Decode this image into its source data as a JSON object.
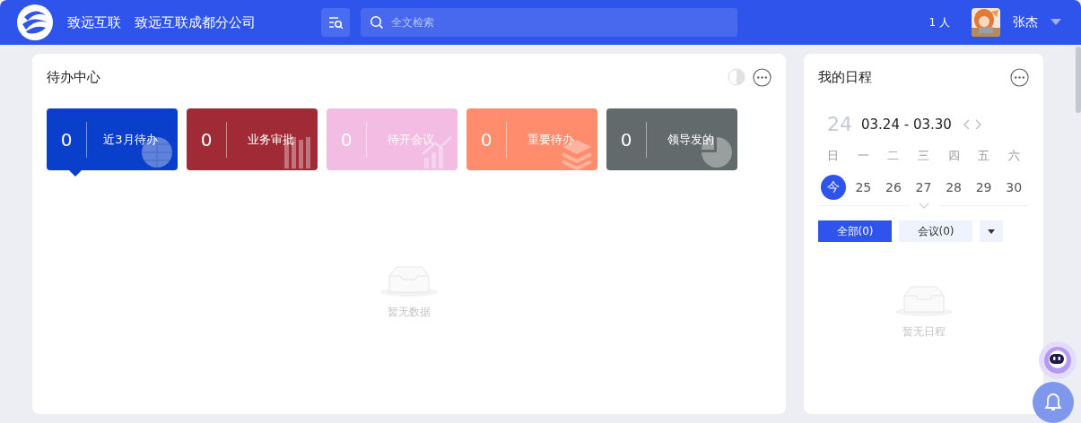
{
  "header": {
    "org": "致远互联",
    "company": "致远互联成都分公司",
    "search": {
      "placeholder": "全文检索"
    },
    "online_count": "1 人",
    "user": {
      "name": "张杰"
    }
  },
  "todo": {
    "title": "待办中心",
    "tiles": [
      {
        "count": "0",
        "label": "近3月待办",
        "color": "#0a3fcc",
        "kind": "globe",
        "selected": true
      },
      {
        "count": "0",
        "label": "业务审批",
        "color": "#a02a36",
        "kind": "books",
        "selected": false
      },
      {
        "count": "0",
        "label": "待开会议",
        "color": "#f2bce3",
        "kind": "chart",
        "selected": false
      },
      {
        "count": "0",
        "label": "重要待办",
        "color": "#ff8c6c",
        "kind": "layers",
        "selected": false
      },
      {
        "count": "0",
        "label": "领导发的",
        "color": "#636a6b",
        "kind": "pie",
        "selected": false
      }
    ],
    "empty_text": "暂无数据"
  },
  "schedule": {
    "title": "我的日程",
    "day": "24",
    "range": "03.24 - 03.30",
    "weekdays": [
      "日",
      "一",
      "二",
      "三",
      "四",
      "五",
      "六"
    ],
    "dates": [
      {
        "label": "今",
        "selected": true
      },
      {
        "label": "25",
        "selected": false
      },
      {
        "label": "26",
        "selected": false
      },
      {
        "label": "27",
        "selected": false
      },
      {
        "label": "28",
        "selected": false
      },
      {
        "label": "29",
        "selected": false
      },
      {
        "label": "30",
        "selected": false
      }
    ],
    "filters": [
      {
        "label": "全部(0)",
        "selected": true
      },
      {
        "label": "会议(0)",
        "selected": false
      }
    ],
    "empty_text": "暂无日程"
  }
}
